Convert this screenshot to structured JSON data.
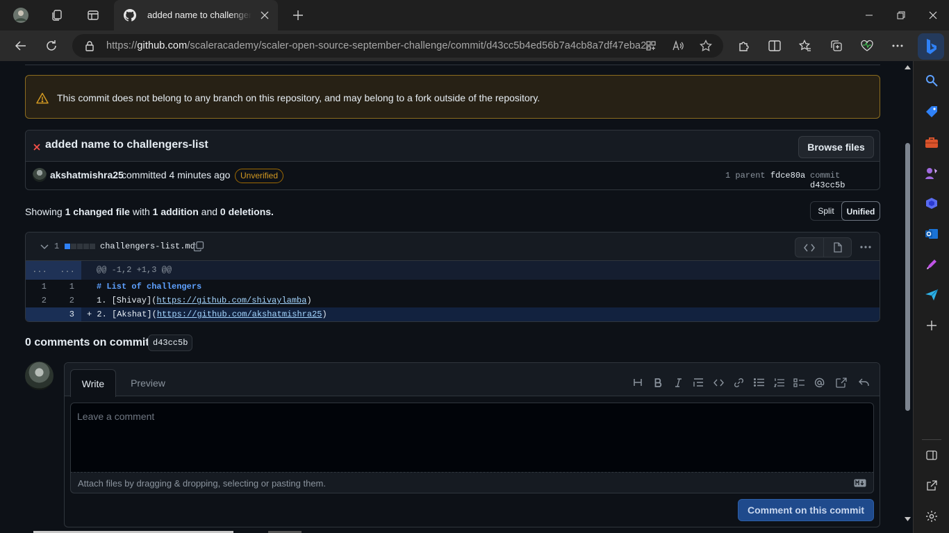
{
  "browser": {
    "tab_title": "added name to challengers-list",
    "url_prefix": "https://",
    "url_host": "github.com",
    "url_path": "/scaleracademy/scaler-open-source-september-challenge/commit/d43cc5b4ed56b7a4cb8a7df47eba2..."
  },
  "page": {
    "flash_warning": "This commit does not belong to any branch on this repository, and may belong to a fork outside of the repository.",
    "commit": {
      "message": "added name to challengers-list",
      "browse_label": "Browse files",
      "author": "akshatmishra25",
      "action": "committed 4 minutes ago",
      "badge": "Unverified",
      "parent_label": "1 parent",
      "parent_sha": "fdce80a",
      "commit_label": "commit",
      "commit_sha": "d43cc5b"
    },
    "summary": {
      "showing": "Showing",
      "changed": "1 changed file",
      "with": "with",
      "additions": "1 addition",
      "and": "and",
      "deletions": "0 deletions",
      "period": "."
    },
    "view_toggle": {
      "split": "Split",
      "unified": "Unified",
      "selected": "Unified"
    },
    "file": {
      "change_count": "1",
      "name": "challengers-list.md",
      "hunk": {
        "left": "...",
        "right": "...",
        "header": "@@ -1,2 +1,3 @@"
      },
      "lines": [
        {
          "old": "1",
          "new": "1",
          "marker": "",
          "heading": "# List of challengers"
        },
        {
          "old": "2",
          "new": "2",
          "marker": "",
          "pre": "1. [Shivay](",
          "link": "https://github.com/shivaylamba",
          "post": ")"
        },
        {
          "old": "",
          "new": "3",
          "marker": "+",
          "pre": "2. [Akshat](",
          "link": "https://github.com/akshatmishra25",
          "post": ")"
        }
      ]
    },
    "comments": {
      "heading": "0 comments on commit",
      "sha": "d43cc5b",
      "tab_write": "Write",
      "tab_preview": "Preview",
      "placeholder": "Leave a comment",
      "attach_hint": "Attach files by dragging & dropping, selecting or pasting them.",
      "submit_label": "Comment on this commit"
    }
  },
  "colors": {
    "background": "#0d1117",
    "warning": "#d29922",
    "danger": "#f85149",
    "accent": "#2f81f7",
    "submit_bg": "#1f4a8c"
  }
}
